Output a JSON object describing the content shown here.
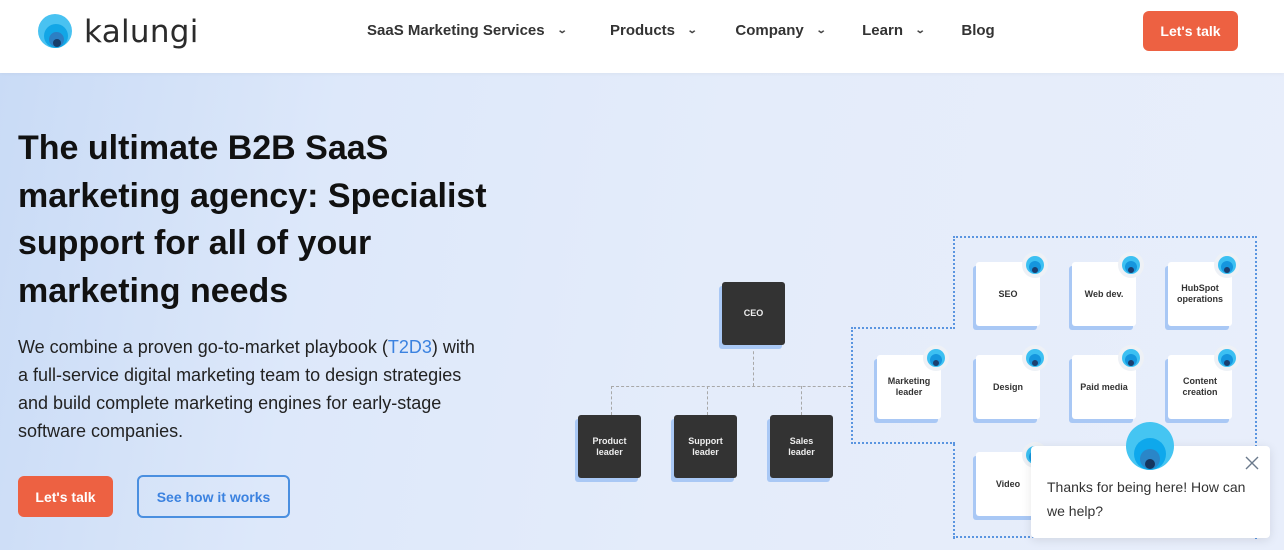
{
  "header": {
    "logo_text": "kalungi",
    "nav": [
      {
        "label": "SaaS Marketing Services",
        "has_dropdown": true
      },
      {
        "label": "Products",
        "has_dropdown": true
      },
      {
        "label": "Company",
        "has_dropdown": true
      },
      {
        "label": "Learn",
        "has_dropdown": true
      },
      {
        "label": "Blog",
        "has_dropdown": false
      }
    ],
    "chevron_glyph": "⌄",
    "cta_label": "Let's talk"
  },
  "hero": {
    "title": "The ultimate B2B SaaS marketing agency: Specialist support for all of your marketing needs",
    "description_before": "We combine a proven go-to-market playbook (",
    "description_link": "T2D3",
    "description_after": ") with a full-service digital marketing team to design strategies and build complete marketing engines for early-stage software companies.",
    "primary_button": "Let's talk",
    "secondary_button": "See how it works"
  },
  "org_chart": {
    "ceo": "CEO",
    "leaders": [
      "Product leader",
      "Support leader",
      "Sales leader"
    ],
    "marketing_team": {
      "leader": "Marketing leader",
      "roles": [
        "SEO",
        "Web dev.",
        "HubSpot operations",
        "Design",
        "Paid media",
        "Content creation",
        "Video"
      ]
    }
  },
  "chat": {
    "message": "Thanks for being here! How can we help?"
  },
  "colors": {
    "accent": "#ed6142",
    "link": "#3b82e0",
    "dark_box": "#333333",
    "logo_blue": "#49c2f1"
  }
}
